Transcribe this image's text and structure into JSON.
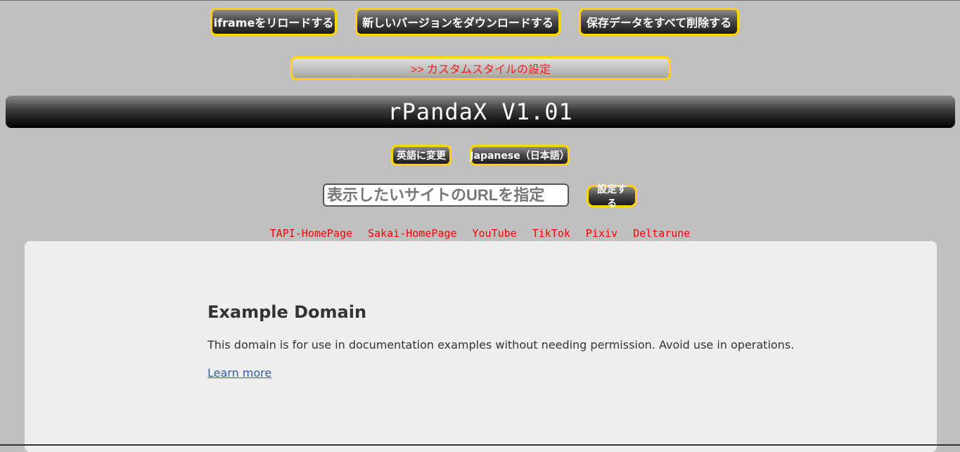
{
  "toolbar": {
    "reload_label": "iframeをリロードする",
    "download_label": "新しいバージョンをダウンロードする",
    "clear_label": "保存データをすべて削除する"
  },
  "custom_style": {
    "label": ">> カスタムスタイルの設定"
  },
  "app": {
    "title": "rPandaX V1.01"
  },
  "language": {
    "english_label": "英語に変更",
    "japanese_label": "Japanese（日本語）"
  },
  "url_form": {
    "placeholder": "表示したいサイトのURLを指定",
    "submit_label": "設定する"
  },
  "quick_links": [
    "TAPI-HomePage",
    "Sakai-HomePage",
    "YouTube",
    "TikTok",
    "Pixiv",
    "Deltarune"
  ],
  "iframe_content": {
    "heading": "Example Domain",
    "body": "This domain is for use in documentation examples without needing permission. Avoid use in operations.",
    "link": "Learn more"
  },
  "colors": {
    "accent_border": "#ffd400",
    "link_red": "#ff0000",
    "page_background": "#c0c0c0"
  }
}
